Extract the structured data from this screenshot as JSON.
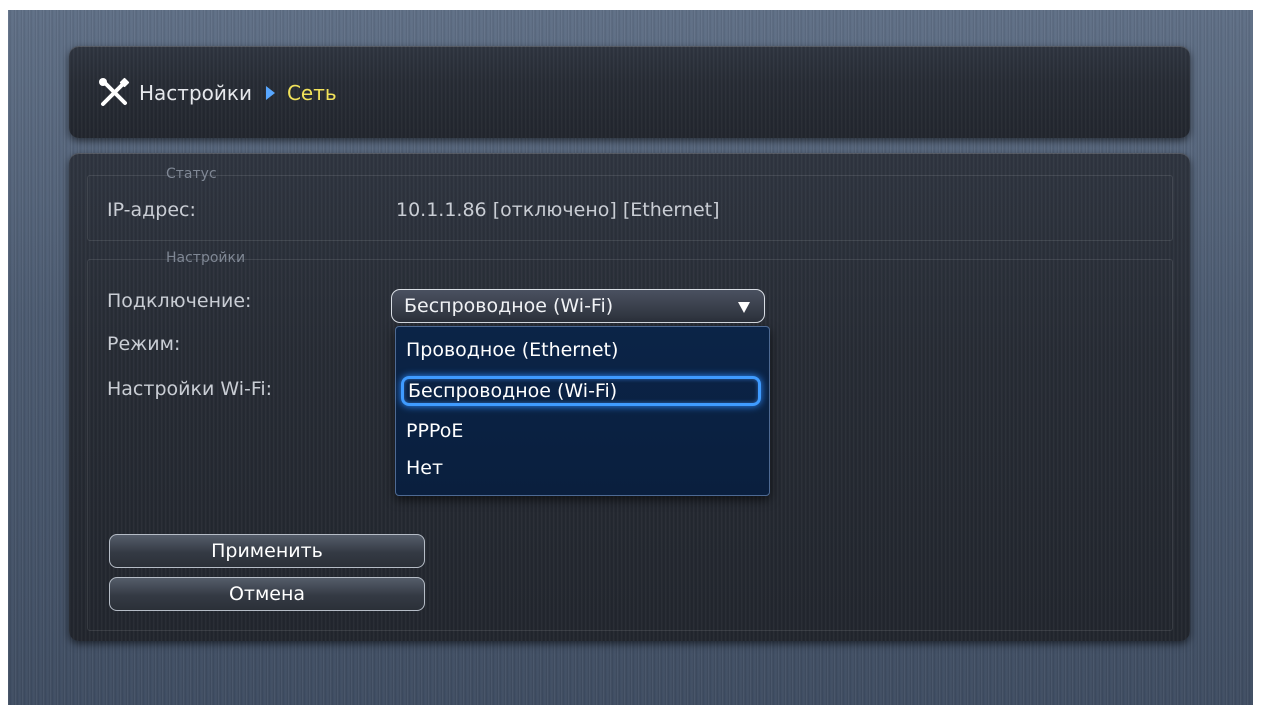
{
  "header": {
    "breadcrumb_root": "Настройки",
    "breadcrumb_current": "Сеть"
  },
  "status": {
    "legend": "Статус",
    "ip_label": "IP-адрес:",
    "ip_value": "10.1.1.86 [отключено] [Ethernet]"
  },
  "settings": {
    "legend": "Настройки",
    "connection_label": "Подключение:",
    "mode_label": "Режим:",
    "wifi_label": "Настройки Wi-Fi:",
    "connection_selected": "Беспроводное (Wi-Fi)",
    "connection_options": [
      "Проводное (Ethernet)",
      "Беспроводное (Wi-Fi)",
      "PPPoE",
      "Нет"
    ]
  },
  "buttons": {
    "apply": "Применить",
    "cancel": "Отмена"
  },
  "colors": {
    "breadcrumb_current": "#f1e25a",
    "breadcrumb_arrow": "#58a7ff",
    "dropdown_bg": "#0b2447",
    "selection_glow": "#3f9bff"
  },
  "icons": {
    "settings": "tools-icon",
    "breadcrumb_separator": "arrow-right-icon",
    "select_caret": "caret-down-icon"
  }
}
